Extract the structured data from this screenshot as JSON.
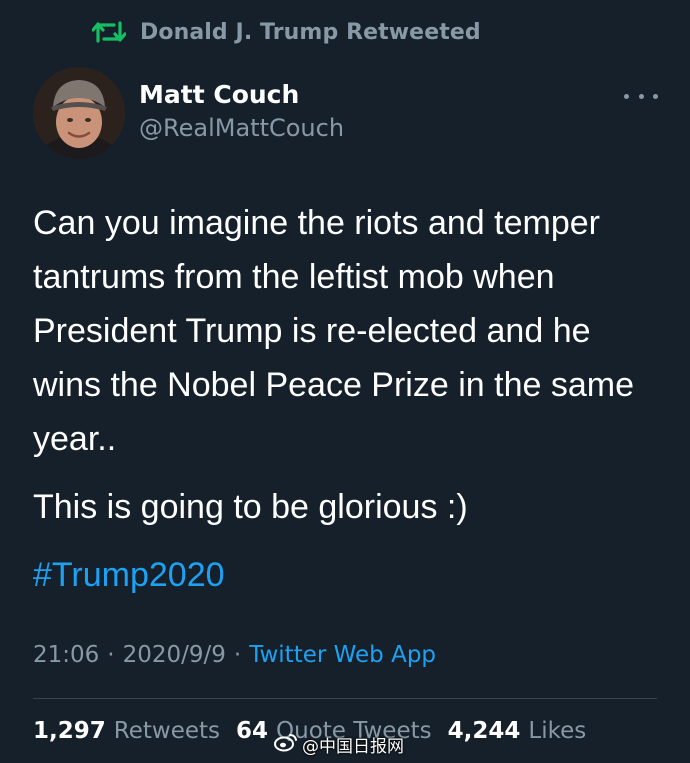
{
  "retweet_context": {
    "icon": "retweet-icon",
    "text": "Donald J. Trump Retweeted"
  },
  "author": {
    "name": "Matt Couch",
    "handle": "@RealMattCouch"
  },
  "more_icon": "more-horizontal-icon",
  "tweet": {
    "paragraph1": "Can you imagine the riots and temper tantrums from the leftist mob when President Trump is re-elected and he wins the Nobel Peace Prize in the same year..",
    "paragraph2": "This is going to be glorious :)",
    "hashtag": "#Trump2020"
  },
  "meta": {
    "time": "21:06",
    "separator": "·",
    "date": "2020/9/9",
    "separator2": "·",
    "source": "Twitter Web App"
  },
  "stats": [
    {
      "count": "1,297",
      "label": "Retweets"
    },
    {
      "count": "64",
      "label": "Quote Tweets"
    },
    {
      "count": "4,244",
      "label": "Likes"
    }
  ],
  "watermark": {
    "text": "@中国日报网",
    "icon": "weibo-icon"
  },
  "colors": {
    "background": "#15202b",
    "accent": "#1da1f2",
    "secondary_text": "#8899a6",
    "retweet_green": "#17bf63"
  }
}
